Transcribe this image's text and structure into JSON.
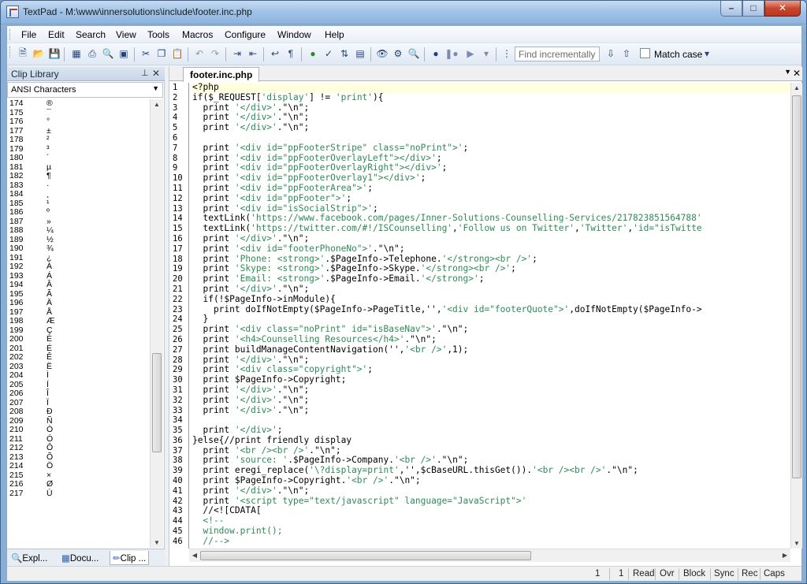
{
  "window": {
    "title": "TextPad - M:\\www\\innersolutions\\include\\footer.inc.php"
  },
  "menu": [
    "File",
    "Edit",
    "Search",
    "View",
    "Tools",
    "Macros",
    "Configure",
    "Window",
    "Help"
  ],
  "toolbar": {
    "find_placeholder": "Find incrementally",
    "match_case_label": "Match case"
  },
  "clip_library": {
    "title": "Clip Library",
    "selected_library": "ANSI Characters",
    "rows": [
      {
        "num": "174",
        "ch": "®"
      },
      {
        "num": "175",
        "ch": "¯"
      },
      {
        "num": "176",
        "ch": "°"
      },
      {
        "num": "177",
        "ch": "±"
      },
      {
        "num": "178",
        "ch": "²"
      },
      {
        "num": "179",
        "ch": "³"
      },
      {
        "num": "180",
        "ch": "´"
      },
      {
        "num": "181",
        "ch": "µ"
      },
      {
        "num": "182",
        "ch": "¶"
      },
      {
        "num": "183",
        "ch": "·"
      },
      {
        "num": "184",
        "ch": "¸"
      },
      {
        "num": "185",
        "ch": "¹"
      },
      {
        "num": "186",
        "ch": "º"
      },
      {
        "num": "187",
        "ch": "»"
      },
      {
        "num": "188",
        "ch": "¼"
      },
      {
        "num": "189",
        "ch": "½"
      },
      {
        "num": "190",
        "ch": "¾"
      },
      {
        "num": "191",
        "ch": "¿"
      },
      {
        "num": "192",
        "ch": "À"
      },
      {
        "num": "193",
        "ch": "Á"
      },
      {
        "num": "194",
        "ch": "Â"
      },
      {
        "num": "195",
        "ch": "Ã"
      },
      {
        "num": "196",
        "ch": "Ä"
      },
      {
        "num": "197",
        "ch": "Å"
      },
      {
        "num": "198",
        "ch": "Æ"
      },
      {
        "num": "199",
        "ch": "Ç"
      },
      {
        "num": "200",
        "ch": "È"
      },
      {
        "num": "201",
        "ch": "É"
      },
      {
        "num": "202",
        "ch": "Ê"
      },
      {
        "num": "203",
        "ch": "Ë"
      },
      {
        "num": "204",
        "ch": "Ì"
      },
      {
        "num": "205",
        "ch": "Í"
      },
      {
        "num": "206",
        "ch": "Î"
      },
      {
        "num": "207",
        "ch": "Ï"
      },
      {
        "num": "208",
        "ch": "Ð"
      },
      {
        "num": "209",
        "ch": "Ñ"
      },
      {
        "num": "210",
        "ch": "Ò"
      },
      {
        "num": "211",
        "ch": "Ó"
      },
      {
        "num": "212",
        "ch": "Ô"
      },
      {
        "num": "213",
        "ch": "Õ"
      },
      {
        "num": "214",
        "ch": "Ö"
      },
      {
        "num": "215",
        "ch": "×"
      },
      {
        "num": "216",
        "ch": "Ø"
      },
      {
        "num": "217",
        "ch": "Ù"
      }
    ],
    "tabs": [
      "Expl...",
      "Docu...",
      "Clip ..."
    ]
  },
  "editor": {
    "tab": "footer.inc.php",
    "lines": [
      [
        [
          "<?php",
          "#000"
        ]
      ],
      [
        [
          "if($_REQUEST[",
          "#000"
        ],
        [
          "'display'",
          "#2e8b57"
        ],
        [
          "] != ",
          "#000"
        ],
        [
          "'print'",
          "#2e8b57"
        ],
        [
          "){",
          "#000"
        ]
      ],
      [
        [
          "  print ",
          "#000"
        ],
        [
          "'</div>'",
          "#2e8b57"
        ],
        [
          ".",
          "#000"
        ],
        [
          "\"\\n\"",
          "#000"
        ],
        [
          ";",
          "#000"
        ]
      ],
      [
        [
          "  print ",
          "#000"
        ],
        [
          "'</div>'",
          "#2e8b57"
        ],
        [
          ".",
          "#000"
        ],
        [
          "\"\\n\"",
          "#000"
        ],
        [
          ";",
          "#000"
        ]
      ],
      [
        [
          "  print ",
          "#000"
        ],
        [
          "'</div>'",
          "#2e8b57"
        ],
        [
          ".",
          "#000"
        ],
        [
          "\"\\n\"",
          "#000"
        ],
        [
          ";",
          "#000"
        ]
      ],
      [
        [
          "",
          "#000"
        ]
      ],
      [
        [
          "  print ",
          "#000"
        ],
        [
          "'<div id=\"ppFooterStripe\" class=\"noPrint\">'",
          "#2e8b57"
        ],
        [
          ";",
          "#000"
        ]
      ],
      [
        [
          "  print ",
          "#000"
        ],
        [
          "'<div id=\"ppFooterOverlayLeft\"></div>'",
          "#2e8b57"
        ],
        [
          ";",
          "#000"
        ]
      ],
      [
        [
          "  print ",
          "#000"
        ],
        [
          "'<div id=\"ppFooterOverlayRight\"></div>'",
          "#2e8b57"
        ],
        [
          ";",
          "#000"
        ]
      ],
      [
        [
          "  print ",
          "#000"
        ],
        [
          "'<div id=\"ppFooterOverlay1\"></div>'",
          "#2e8b57"
        ],
        [
          ";",
          "#000"
        ]
      ],
      [
        [
          "  print ",
          "#000"
        ],
        [
          "'<div id=\"ppFooterArea\">'",
          "#2e8b57"
        ],
        [
          ";",
          "#000"
        ]
      ],
      [
        [
          "  print ",
          "#000"
        ],
        [
          "'<div id=\"ppFooter\">'",
          "#2e8b57"
        ],
        [
          ";",
          "#000"
        ]
      ],
      [
        [
          "  print ",
          "#000"
        ],
        [
          "'<div id=\"isSocialStrip\">'",
          "#2e8b57"
        ],
        [
          ";",
          "#000"
        ]
      ],
      [
        [
          "  textLink(",
          "#000"
        ],
        [
          "'https://www.facebook.com/pages/Inner-Solutions-Counselling-Services/217823851564788'",
          "#2e8b57"
        ]
      ],
      [
        [
          "  textLink(",
          "#000"
        ],
        [
          "'https://twitter.com/#!/ISCounselling'",
          "#2e8b57"
        ],
        [
          ",",
          "#000"
        ],
        [
          "'Follow us on Twitter'",
          "#2e8b57"
        ],
        [
          ",",
          "#000"
        ],
        [
          "'Twitter'",
          "#2e8b57"
        ],
        [
          ",",
          "#000"
        ],
        [
          "'id=\"isTwitte",
          "#2e8b57"
        ]
      ],
      [
        [
          "  print ",
          "#000"
        ],
        [
          "'</div>'",
          "#2e8b57"
        ],
        [
          ".",
          "#000"
        ],
        [
          "\"\\n\"",
          "#000"
        ],
        [
          ";",
          "#000"
        ]
      ],
      [
        [
          "  print ",
          "#000"
        ],
        [
          "'<div id=\"footerPhoneNo\">'",
          "#2e8b57"
        ],
        [
          ".",
          "#000"
        ],
        [
          "\"\\n\"",
          "#000"
        ],
        [
          ";",
          "#000"
        ]
      ],
      [
        [
          "  print ",
          "#000"
        ],
        [
          "'Phone: <strong>'",
          "#2e8b57"
        ],
        [
          ".$PageInfo->Telephone.",
          "#000"
        ],
        [
          "'</strong><br />'",
          "#2e8b57"
        ],
        [
          ";",
          "#000"
        ]
      ],
      [
        [
          "  print ",
          "#000"
        ],
        [
          "'Skype: <strong>'",
          "#2e8b57"
        ],
        [
          ".$PageInfo->Skype.",
          "#000"
        ],
        [
          "'</strong><br />'",
          "#2e8b57"
        ],
        [
          ";",
          "#000"
        ]
      ],
      [
        [
          "  print ",
          "#000"
        ],
        [
          "'Email: <strong>'",
          "#2e8b57"
        ],
        [
          ".$PageInfo->Email.",
          "#000"
        ],
        [
          "'</strong>'",
          "#2e8b57"
        ],
        [
          ";",
          "#000"
        ]
      ],
      [
        [
          "  print ",
          "#000"
        ],
        [
          "'</div>'",
          "#2e8b57"
        ],
        [
          ".",
          "#000"
        ],
        [
          "\"\\n\"",
          "#000"
        ],
        [
          ";",
          "#000"
        ]
      ],
      [
        [
          "  if(!$PageInfo->inModule){",
          "#000"
        ]
      ],
      [
        [
          "    print doIfNotEmpty($PageInfo->PageTitle,'',",
          "#000"
        ],
        [
          "'<div id=\"footerQuote\">'",
          "#2e8b57"
        ],
        [
          ",doIfNotEmpty($PageInfo->",
          "#000"
        ]
      ],
      [
        [
          "  }",
          "#000"
        ]
      ],
      [
        [
          "  print ",
          "#000"
        ],
        [
          "'<div class=\"noPrint\" id=\"isBaseNav\">'",
          "#2e8b57"
        ],
        [
          ".",
          "#000"
        ],
        [
          "\"\\n\"",
          "#000"
        ],
        [
          ";",
          "#000"
        ]
      ],
      [
        [
          "  print ",
          "#000"
        ],
        [
          "'<h4>Counselling Resources</h4>'",
          "#2e8b57"
        ],
        [
          ".",
          "#000"
        ],
        [
          "\"\\n\"",
          "#000"
        ],
        [
          ";",
          "#000"
        ]
      ],
      [
        [
          "  print buildManageContentNavigation('',",
          "#000"
        ],
        [
          "'<br />'",
          "#2e8b57"
        ],
        [
          ",1);",
          "#000"
        ]
      ],
      [
        [
          "  print ",
          "#000"
        ],
        [
          "'</div>'",
          "#2e8b57"
        ],
        [
          ".",
          "#000"
        ],
        [
          "\"\\n\"",
          "#000"
        ],
        [
          ";",
          "#000"
        ]
      ],
      [
        [
          "  print ",
          "#000"
        ],
        [
          "'<div class=\"copyright\">'",
          "#2e8b57"
        ],
        [
          ";",
          "#000"
        ]
      ],
      [
        [
          "  print $PageInfo->Copyright;",
          "#000"
        ]
      ],
      [
        [
          "  print ",
          "#000"
        ],
        [
          "'</div>'",
          "#2e8b57"
        ],
        [
          ".",
          "#000"
        ],
        [
          "\"\\n\"",
          "#000"
        ],
        [
          ";",
          "#000"
        ]
      ],
      [
        [
          "  print ",
          "#000"
        ],
        [
          "'</div>'",
          "#2e8b57"
        ],
        [
          ".",
          "#000"
        ],
        [
          "\"\\n\"",
          "#000"
        ],
        [
          ";",
          "#000"
        ]
      ],
      [
        [
          "  print ",
          "#000"
        ],
        [
          "'</div>'",
          "#2e8b57"
        ],
        [
          ".",
          "#000"
        ],
        [
          "\"\\n\"",
          "#000"
        ],
        [
          ";",
          "#000"
        ]
      ],
      [
        [
          "",
          "#000"
        ]
      ],
      [
        [
          "  print ",
          "#000"
        ],
        [
          "'</div>'",
          "#2e8b57"
        ],
        [
          ";",
          "#000"
        ]
      ],
      [
        [
          "}else{",
          "#000"
        ],
        [
          "//print friendly display",
          "#000"
        ]
      ],
      [
        [
          "  print ",
          "#000"
        ],
        [
          "'<br /><br />'",
          "#2e8b57"
        ],
        [
          ".",
          "#000"
        ],
        [
          "\"\\n\"",
          "#000"
        ],
        [
          ";",
          "#000"
        ]
      ],
      [
        [
          "  print ",
          "#000"
        ],
        [
          "'source: '",
          "#2e8b57"
        ],
        [
          ".$PageInfo->Company.",
          "#000"
        ],
        [
          "'<br />'",
          "#2e8b57"
        ],
        [
          ".",
          "#000"
        ],
        [
          "\"\\n\"",
          "#000"
        ],
        [
          ";",
          "#000"
        ]
      ],
      [
        [
          "  print eregi_replace(",
          "#000"
        ],
        [
          "'\\?display=print'",
          "#2e8b57"
        ],
        [
          ",'',$cBaseURL.thisGet()).",
          "#000"
        ],
        [
          "'<br /><br />'",
          "#2e8b57"
        ],
        [
          ".",
          "#000"
        ],
        [
          "\"\\n\"",
          "#000"
        ],
        [
          ";",
          "#000"
        ]
      ],
      [
        [
          "  print $PageInfo->Copyright.",
          "#000"
        ],
        [
          "'<br />'",
          "#2e8b57"
        ],
        [
          ".",
          "#000"
        ],
        [
          "\"\\n\"",
          "#000"
        ],
        [
          ";",
          "#000"
        ]
      ],
      [
        [
          "  print ",
          "#000"
        ],
        [
          "'</div>'",
          "#2e8b57"
        ],
        [
          ".",
          "#000"
        ],
        [
          "\"\\n\"",
          "#000"
        ],
        [
          ";",
          "#000"
        ]
      ],
      [
        [
          "  print ",
          "#000"
        ],
        [
          "'<script type=\"text/javascript\" language=\"JavaScript\">'",
          "#2e8b57"
        ]
      ],
      [
        [
          "  //<![CDATA[",
          "#000"
        ]
      ],
      [
        [
          "  <!--",
          "#2e8b57"
        ]
      ],
      [
        [
          "  window.print();",
          "#2e8b57"
        ]
      ],
      [
        [
          "  //-->",
          "#2e8b57"
        ]
      ]
    ]
  },
  "status": {
    "line": "1",
    "col": "1",
    "read": "Read",
    "ovr": "Ovr",
    "block": "Block",
    "sync": "Sync",
    "rec": "Rec",
    "caps": "Caps"
  },
  "colors": {
    "string": "#2e8b57",
    "code": "#000000",
    "accent": "#88aed6"
  }
}
